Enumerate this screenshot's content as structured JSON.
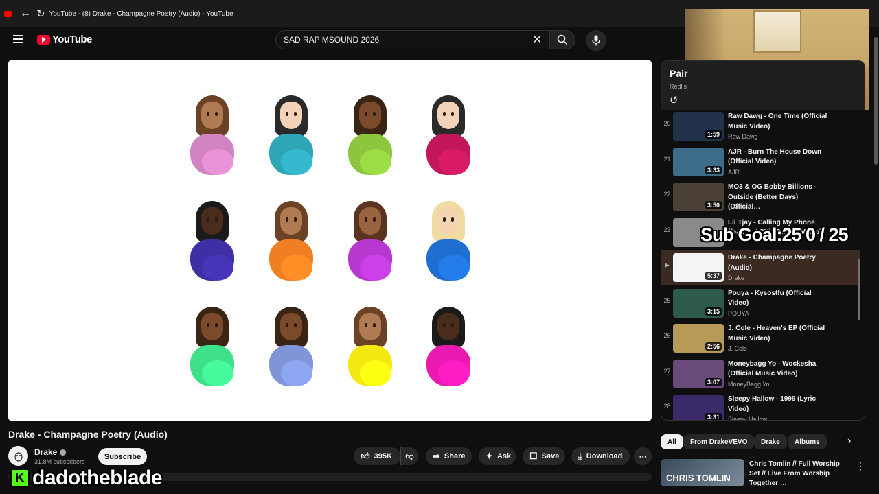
{
  "browser": {
    "tab_title": "YouTube - (8) Drake - Champagne Poetry (Audio) - YouTube"
  },
  "header": {
    "logo_text": "YouTube",
    "search_value": "SAD RAP MSOUND 2026"
  },
  "video": {
    "title": "Drake - Champagne Poetry (Audio)",
    "channel": "Drake",
    "subscribers": "31.8M subscribers",
    "subscribe_label": "Subscribe",
    "likes": "395K",
    "share_label": "Share",
    "ask_label": "Ask",
    "save_label": "Save",
    "download_label": "Download",
    "emoji_grid": [
      {
        "skin": "#b07a52",
        "hair": "#6b4226",
        "shirt": "#d283c2"
      },
      {
        "skin": "#f3d2b8",
        "hair": "#2a2a2a",
        "shirt": "#2fa5b8"
      },
      {
        "skin": "#7a4a2a",
        "hair": "#3a2414",
        "shirt": "#8cc63f"
      },
      {
        "skin": "#f3d2b8",
        "hair": "#2a2a2a",
        "shirt": "#c2185b"
      },
      {
        "skin": "#4a2c1c",
        "hair": "#1a1a1a",
        "shirt": "#3f2fa5"
      },
      {
        "skin": "#b07a52",
        "hair": "#6b4226",
        "shirt": "#ef7f22"
      },
      {
        "skin": "#9a6440",
        "hair": "#5a3420",
        "shirt": "#b638d0"
      },
      {
        "skin": "#f5d4b0",
        "hair": "#f0dca0",
        "shirt": "#1f6fd1"
      },
      {
        "skin": "#7a4a2a",
        "hair": "#3a2414",
        "shirt": "#3ee08a"
      },
      {
        "skin": "#7a4a2a",
        "hair": "#3a2414",
        "shirt": "#7f95d8"
      },
      {
        "skin": "#b07a52",
        "hair": "#6b4226",
        "shirt": "#f4e812"
      },
      {
        "skin": "#4a2c1c",
        "hair": "#1a1a1a",
        "shirt": "#e81ab0"
      }
    ]
  },
  "playlist": {
    "title": "Pair",
    "subtitle": "Redlis",
    "items": [
      {
        "index": "20",
        "title": "Raw Dawg - One Time (Official Music Video)",
        "channel": "Raw Dawg",
        "duration": "1:59",
        "thumb": "#22324a"
      },
      {
        "index": "21",
        "title": "AJR - Burn The House Down (Official Video)",
        "channel": "AJR",
        "duration": "3:33",
        "thumb": "#3d6d88"
      },
      {
        "index": "22",
        "title": "MO3 & OG Bobby Billions - Outside (Better Days) (Official…",
        "channel": "HSM",
        "duration": "3:50",
        "thumb": "#4a4036"
      },
      {
        "index": "23",
        "title": "Lil Tjay - Calling My Phone (feat. 6LACK) [Official Video]",
        "channel": "",
        "duration": "",
        "thumb": "#8a8a8a"
      },
      {
        "index": "",
        "title": "Drake - Champagne Poetry (Audio)",
        "channel": "Drake",
        "duration": "5:37",
        "thumb": "#f4f4f4",
        "active": true
      },
      {
        "index": "25",
        "title": "Pouya - Kysostfu (Official Video)",
        "channel": "POUYA",
        "duration": "3:15",
        "thumb": "#2e5a4a"
      },
      {
        "index": "26",
        "title": "J. Cole - Heaven's EP (Official Music Video)",
        "channel": "J. Cole",
        "duration": "2:56",
        "thumb": "#b79a58"
      },
      {
        "index": "27",
        "title": "Moneybagg Yo - Wockesha (Official Music Video)",
        "channel": "MoneyBagg Yo",
        "duration": "3:07",
        "thumb": "#6a4a7a"
      },
      {
        "index": "28",
        "title": "Sleepy Hallow - 1999 (Lyric Video)",
        "channel": "Sleepy Hallow",
        "duration": "3:31",
        "thumb": "#3a2a6a"
      }
    ]
  },
  "chips": [
    "All",
    "From DrakeVEVO",
    "Drake",
    "Albums"
  ],
  "recommendation": {
    "title": "Chris Tomlin // Full Worship Set // Live From Worship Together …",
    "thumb_text": "CHRIS TOMLIN"
  },
  "overlay": {
    "sub_goal": "Sub Goal:25  0 / 25",
    "streamer": "dadotheblade",
    "kick_letter": "K"
  }
}
